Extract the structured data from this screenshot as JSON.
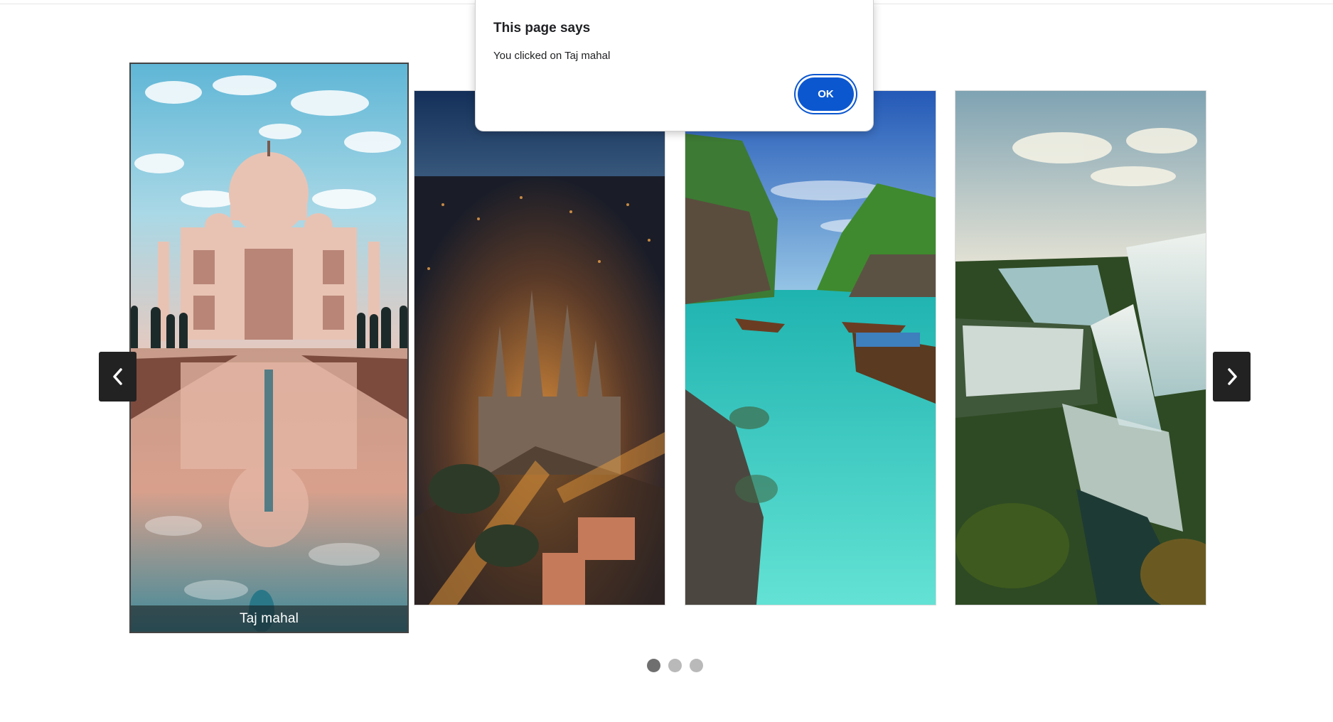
{
  "dialog": {
    "title": "This page says",
    "message": "You clicked on Taj mahal",
    "ok_label": "OK"
  },
  "carousel": {
    "prev_icon": "chevron-left-icon",
    "next_icon": "chevron-right-icon",
    "slides": [
      {
        "image": "taj-mahal-photo",
        "caption": "Taj mahal",
        "active": true
      },
      {
        "image": "night-city-cathedral-photo"
      },
      {
        "image": "tropical-lagoon-boats-photo"
      },
      {
        "image": "waterfall-canyon-photo"
      }
    ],
    "dots": [
      {
        "active": true
      },
      {
        "active": false
      },
      {
        "active": false
      }
    ]
  },
  "colors": {
    "dialog_accent": "#0b57d0",
    "arrow_bg": "#222222",
    "dot_active": "#6f6f6f",
    "dot_inactive": "#b9b9b9"
  }
}
